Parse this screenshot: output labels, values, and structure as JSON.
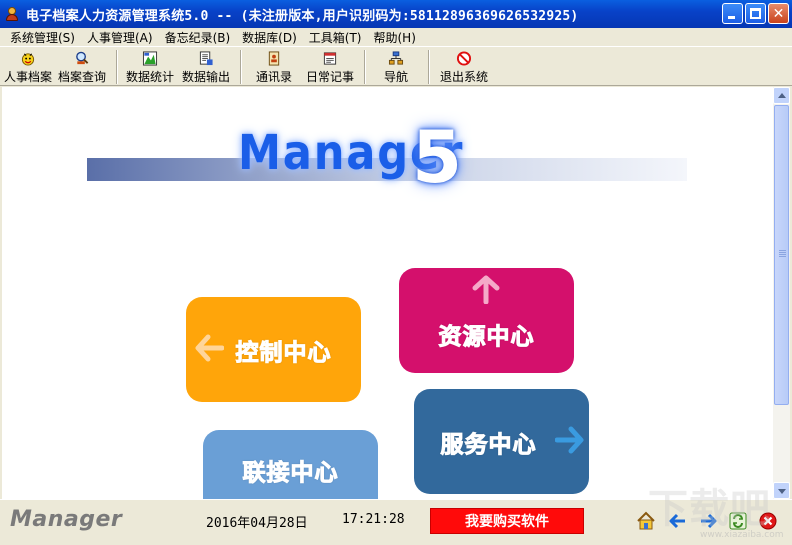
{
  "window": {
    "title": "电子档案人力资源管理系统5.0 -- (未注册版本,用户识别码为:58112896369626532925)"
  },
  "menu": [
    {
      "label": "系统管理(S)"
    },
    {
      "label": "人事管理(A)"
    },
    {
      "label": "备忘纪录(B)"
    },
    {
      "label": "数据库(D)"
    },
    {
      "label": "工具箱(T)"
    },
    {
      "label": "帮助(H)"
    }
  ],
  "toolbar": {
    "personnel": "人事档案",
    "search": "档案查询",
    "stats": "数据统计",
    "export": "数据输出",
    "contacts": "通讯录",
    "diary": "日常记事",
    "navigate": "导航",
    "exit": "退出系统"
  },
  "banner": {
    "word": "Manager",
    "version": "5"
  },
  "tiles": {
    "control": "控制中心",
    "resource": "资源中心",
    "service": "服务中心",
    "link": "联接中心"
  },
  "colors": {
    "control": "#ffa50a",
    "resource": "#d4106c",
    "service": "#32699c",
    "link": "#6a9fd6",
    "buy": "#ff0a0a"
  },
  "statusbar": {
    "logo": "Manager",
    "date": "2016年04月28日",
    "time": "17:21:28",
    "buy": "我要购买软件"
  },
  "icons": {
    "status": [
      "home-icon",
      "back-arrow-icon",
      "forward-arrow-icon",
      "refresh-icon",
      "close-icon"
    ]
  },
  "watermark": {
    "text": "下载吧",
    "url": "www.xiazaiba.com"
  }
}
